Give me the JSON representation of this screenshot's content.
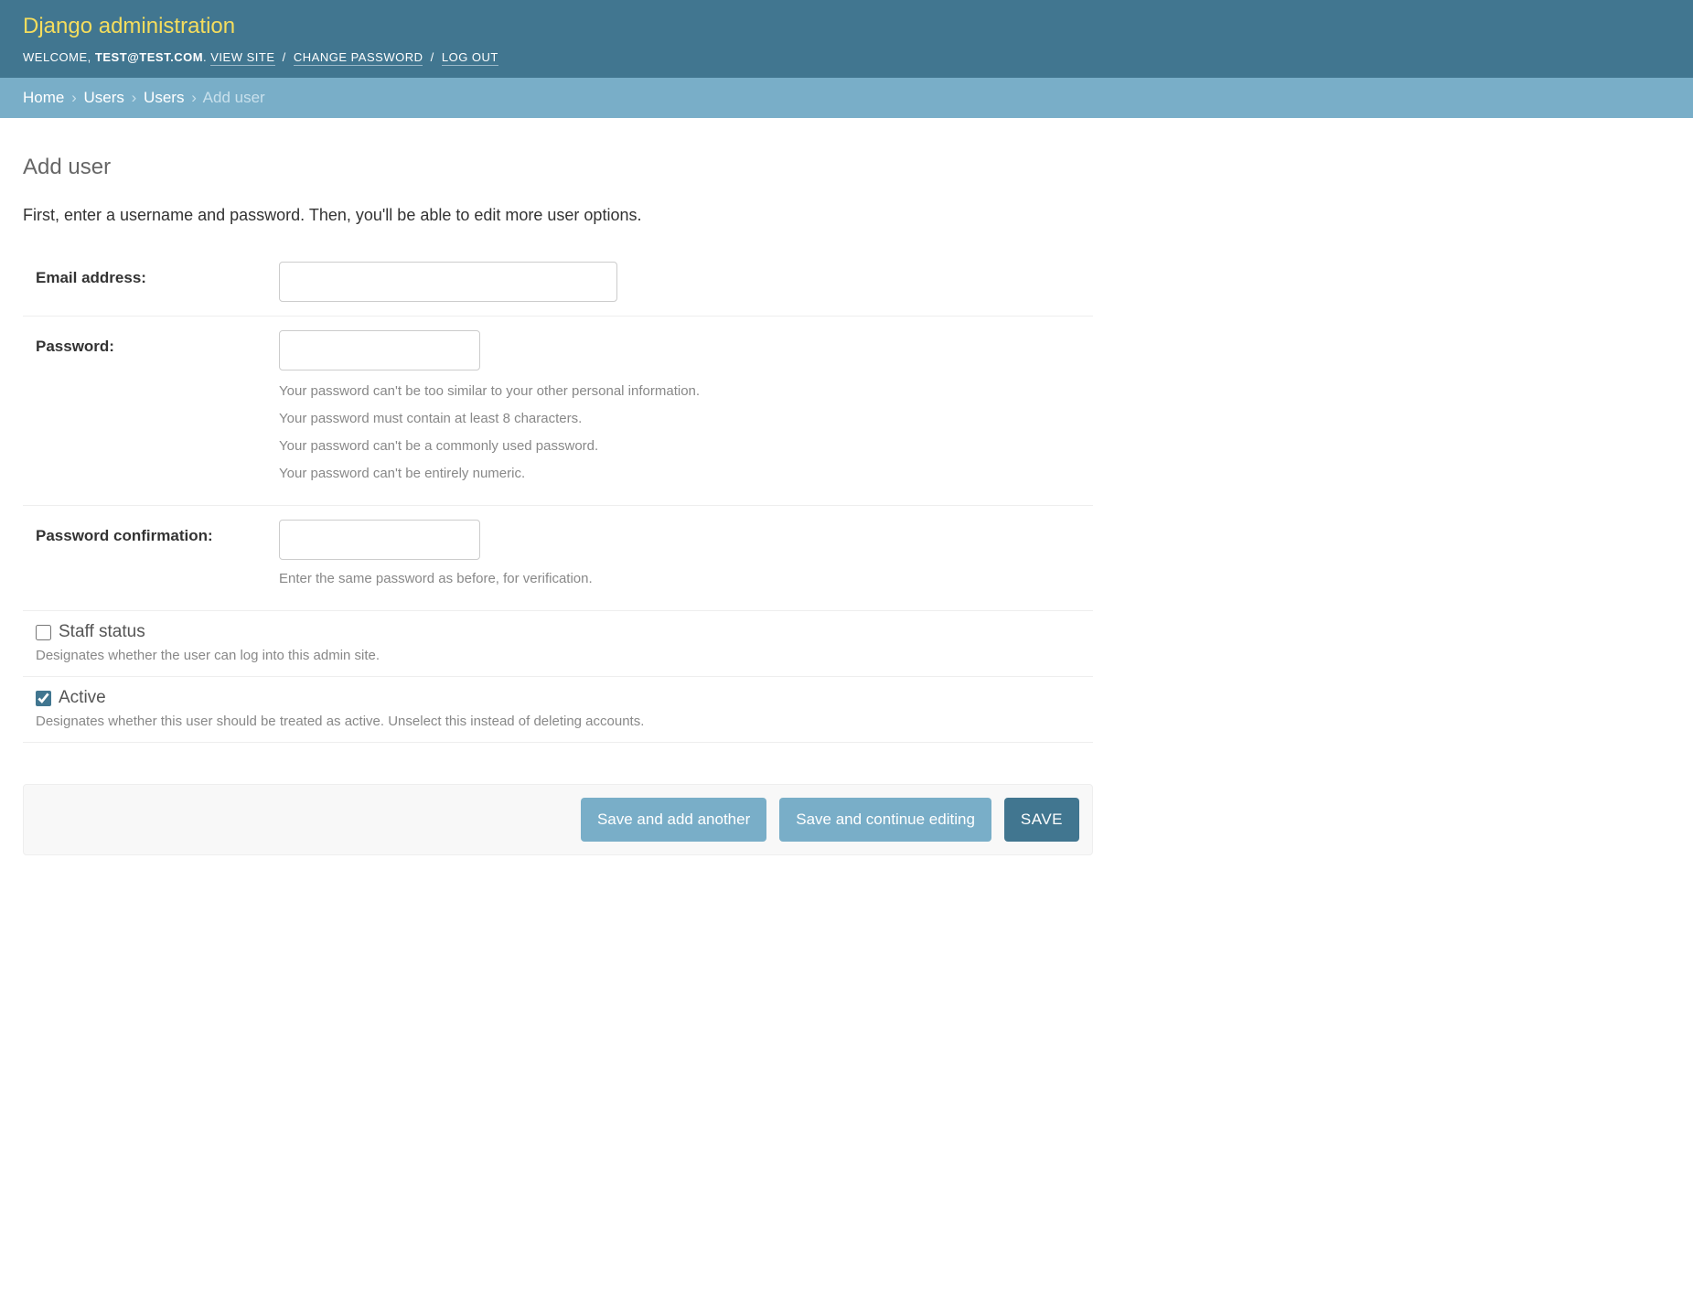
{
  "header": {
    "branding": "Django administration",
    "welcome_label": "WELCOME, ",
    "username": "TEST@TEST.COM",
    "view_site": "VIEW SITE",
    "change_password": "CHANGE PASSWORD",
    "logout": "LOG OUT"
  },
  "breadcrumbs": {
    "home": "Home",
    "app": "Users",
    "model": "Users",
    "current": "Add user"
  },
  "page": {
    "title": "Add user",
    "intro": "First, enter a username and password. Then, you'll be able to edit more user options."
  },
  "form": {
    "email_label": "Email address:",
    "email_value": "",
    "password_label": "Password:",
    "password_value": "",
    "password_hints": [
      "Your password can't be too similar to your other personal information.",
      "Your password must contain at least 8 characters.",
      "Your password can't be a commonly used password.",
      "Your password can't be entirely numeric."
    ],
    "password2_label": "Password confirmation:",
    "password2_value": "",
    "password2_help": "Enter the same password as before, for verification.",
    "staff_label": "Staff status",
    "staff_checked": false,
    "staff_help": "Designates whether the user can log into this admin site.",
    "active_label": "Active",
    "active_checked": true,
    "active_help": "Designates whether this user should be treated as active. Unselect this instead of deleting accounts."
  },
  "buttons": {
    "save_add_another": "Save and add another",
    "save_continue": "Save and continue editing",
    "save": "SAVE"
  }
}
